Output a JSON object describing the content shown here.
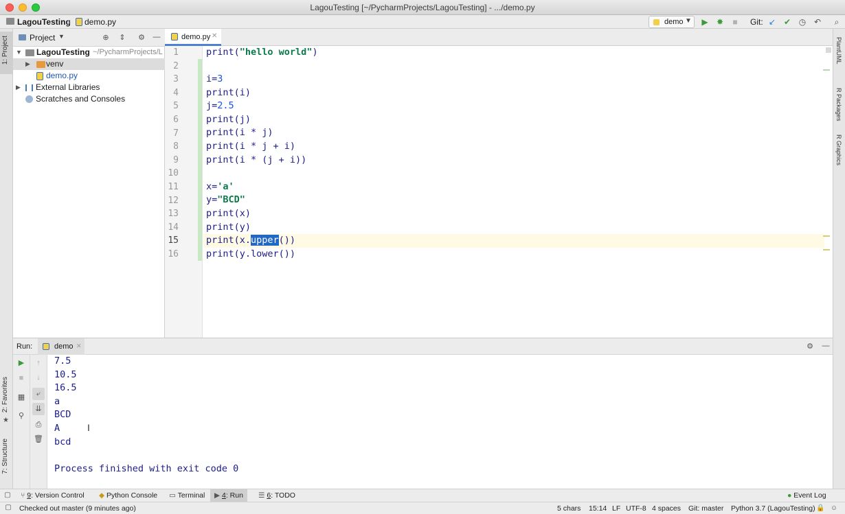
{
  "window": {
    "title": "LagouTesting [~/PycharmProjects/LagouTesting] - .../demo.py"
  },
  "navbar": {
    "breadcrumb_project": "LagouTesting",
    "breadcrumb_file": "demo.py",
    "run_config": "demo",
    "git_label": "Git:"
  },
  "sidebar_left": {
    "project_tab": "1: Project",
    "favorites_tab": "2: Favorites",
    "structure_tab": "7: Structure"
  },
  "sidebar_right": {
    "plantuml": "PlantUML",
    "r_packages": "R Packages",
    "r_graphics": "R Graphics"
  },
  "project_panel": {
    "title": "Project",
    "tree": [
      {
        "label": "LagouTesting",
        "suffix": "~/PycharmProjects/L"
      },
      {
        "label": "venv"
      },
      {
        "label": "demo.py"
      },
      {
        "label": "External Libraries"
      },
      {
        "label": "Scratches and Consoles"
      }
    ]
  },
  "editor": {
    "tab_label": "demo.py",
    "line_numbers": [
      "1",
      "2",
      "3",
      "4",
      "5",
      "6",
      "7",
      "8",
      "9",
      "10",
      "11",
      "12",
      "13",
      "14",
      "15",
      "16"
    ],
    "active_line": 15,
    "selected_word": "upper"
  },
  "run_panel": {
    "label": "Run:",
    "tab": "demo",
    "output": [
      "7.5",
      "10.5",
      "16.5",
      "a",
      "BCD",
      "A",
      "bcd",
      "",
      "Process finished with exit code 0"
    ]
  },
  "bottom_tabs": [
    {
      "key": "9",
      "label": ": Version Control"
    },
    {
      "key": "",
      "label": "Python Console"
    },
    {
      "key": "",
      "label": "Terminal"
    },
    {
      "key": "4",
      "label": ": Run"
    },
    {
      "key": "6",
      "label": ": TODO"
    }
  ],
  "event_log": "Event Log",
  "status": {
    "message": "Checked out master (9 minutes ago)",
    "selection": "5 chars",
    "position": "15:14",
    "line_sep": "LF",
    "encoding": "UTF-8",
    "indent": "4 spaces",
    "git_branch": "Git: master",
    "interpreter": "Python 3.7 (LagouTesting)"
  },
  "colors": {
    "accent": "#2167c4",
    "run_green": "#3c9a3c",
    "code_blue": "#1c1c88",
    "string_green": "#0b7a4b"
  }
}
